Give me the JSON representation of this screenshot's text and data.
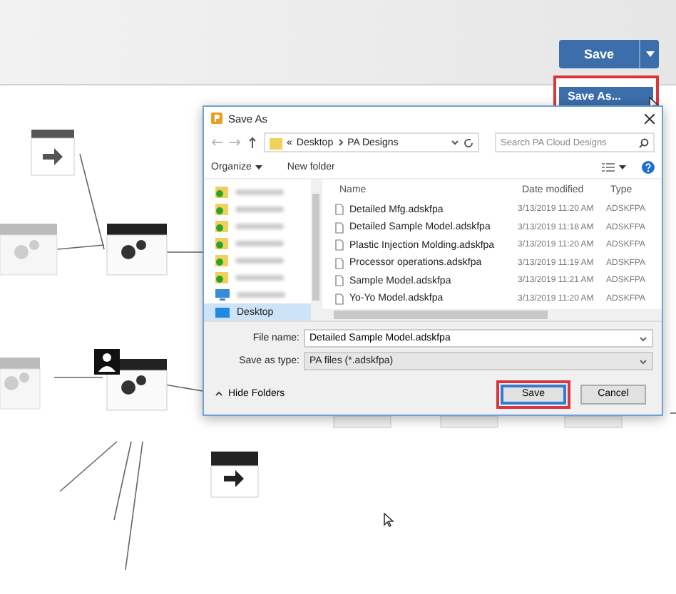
{
  "toolbar": {
    "save_button": "Save",
    "save_as_item": {
      "label": "Save As...",
      "highlighted": true
    }
  },
  "dialog": {
    "title": "Save As",
    "path_prefix": "«",
    "path": [
      "Desktop",
      "PA Designs"
    ],
    "search": {
      "placeholder": "Search PA Cloud Designs"
    },
    "commands": {
      "organize": "Organize",
      "new_folder": "New folder"
    },
    "nav_items": [
      {
        "kind": "cloud-folder",
        "selected": false
      },
      {
        "kind": "cloud-folder",
        "selected": false
      },
      {
        "kind": "cloud-folder",
        "selected": false
      },
      {
        "kind": "cloud-folder",
        "selected": false
      },
      {
        "kind": "cloud-folder",
        "selected": false
      },
      {
        "kind": "cloud-folder",
        "selected": false
      },
      {
        "kind": "computer",
        "selected": false
      },
      {
        "kind": "desktop",
        "label": "Desktop",
        "selected": true
      }
    ],
    "columns": [
      "Name",
      "Date modified",
      "Type"
    ],
    "files": [
      {
        "name": "Detailed Mfg.adskfpa",
        "date": "3/13/2019 11:20 AM",
        "type": "ADSKFPA"
      },
      {
        "name": "Detailed Sample Model.adskfpa",
        "date": "3/13/2019 11:18 AM",
        "type": "ADSKFPA"
      },
      {
        "name": "Plastic Injection Molding.adskfpa",
        "date": "3/13/2019 11:20 AM",
        "type": "ADSKFPA"
      },
      {
        "name": "Processor operations.adskfpa",
        "date": "3/13/2019 11:19 AM",
        "type": "ADSKFPA"
      },
      {
        "name": "Sample Model.adskfpa",
        "date": "3/13/2019 11:21 AM",
        "type": "ADSKFPA"
      },
      {
        "name": "Yo-Yo Model.adskfpa",
        "date": "3/13/2019 11:20 AM",
        "type": "ADSKFPA"
      }
    ],
    "file_name": {
      "label": "File name:",
      "value": "Detailed Sample Model.adskfpa"
    },
    "save_type": {
      "label": "Save as type:",
      "value": "PA files (*.adskfpa)"
    },
    "hide_folders": "Hide Folders",
    "buttons": [
      {
        "kind": "save",
        "label": "Save",
        "highlighted": true
      },
      {
        "kind": "cancel",
        "label": "Cancel",
        "highlighted": false
      }
    ]
  }
}
